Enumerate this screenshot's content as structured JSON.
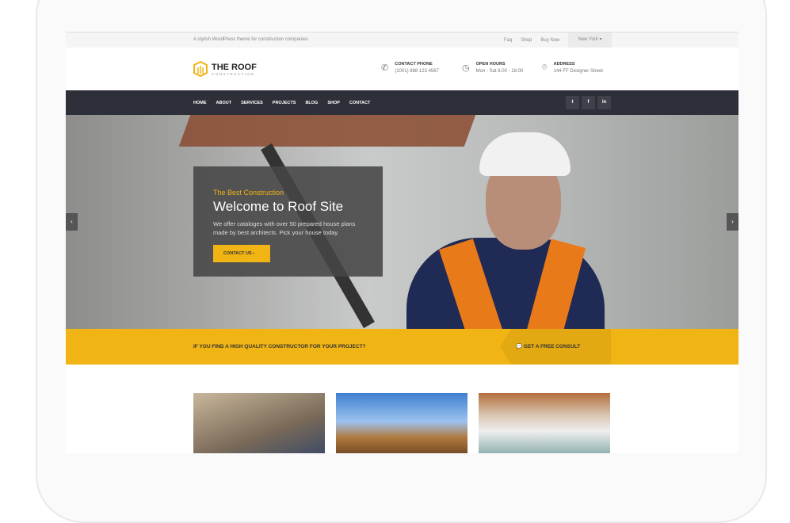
{
  "topbar": {
    "tagline": "A stylish WordPress theme for construction companies",
    "links": [
      "Faq",
      "Shop",
      "Buy Now"
    ],
    "city": "New York"
  },
  "logo": {
    "title": "THE ROOF",
    "subtitle": "CONSTRUCTION"
  },
  "info": [
    {
      "label": "CONTACT PHONE",
      "value": "(1001) 888 123 4567"
    },
    {
      "label": "OPEN HOURS",
      "value": "Mon - Sat 8.00 - 18.00"
    },
    {
      "label": "ADDRESS",
      "value": "144 FF Designer Street"
    }
  ],
  "nav": [
    "HOME",
    "ABOUT",
    "SERVICES",
    "PROJECTS",
    "BLOG",
    "SHOP",
    "CONTACT"
  ],
  "social": [
    "t",
    "f",
    "in"
  ],
  "hero": {
    "subtitle": "The Best Construction",
    "title": "Welcome to Roof Site",
    "text": "We offer cataloges with over 50 prepared house plans made by best architects. Pick your house today.",
    "button": "CONTACT US ›"
  },
  "cta": {
    "question": "IF YOU FIND A HIGH QUALITY CONSTRUCTOR FOR YOUR PROJECT?",
    "button": "GET A FREE CONSULT"
  },
  "colors": {
    "accent": "#f0b414",
    "nav": "#2d3038"
  }
}
